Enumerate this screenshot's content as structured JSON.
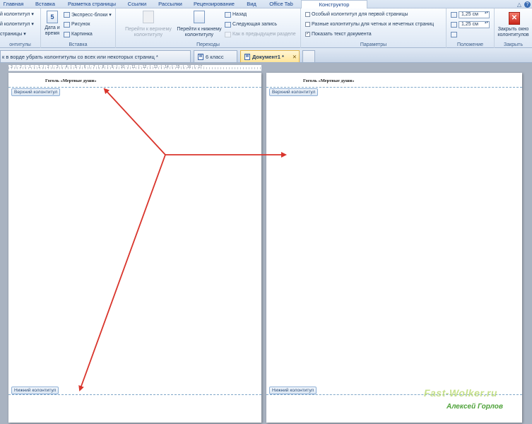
{
  "ribbon_tabs": [
    "Главная",
    "Вставка",
    "Разметка страницы",
    "Ссылки",
    "Рассылки",
    "Рецензирование",
    "Вид",
    "Office Tab",
    "Конструктор"
  ],
  "window_icons": [
    "△",
    "?"
  ],
  "ribbon": {
    "group1": {
      "items": [
        "й колонтитул ▾",
        "й колонтитул ▾",
        "страницы ▾"
      ],
      "label": "онтитулы"
    },
    "insert": {
      "date_label_1": "Дата и",
      "date_label_2": "время",
      "date_icon_text": "5",
      "items": [
        "Экспресс-блоки ▾",
        "Рисунок",
        "Картинка"
      ],
      "label": "Вставка"
    },
    "nav": {
      "goto_header_1": "Перейти к верхнему",
      "goto_header_2": "колонтитулу",
      "goto_footer_1": "Перейти к нижнему",
      "goto_footer_2": "колонтитулу",
      "items": [
        "Назад",
        "Следующая запись",
        "Как в предыдущем разделе"
      ],
      "label": "Переходы"
    },
    "params": {
      "options": [
        {
          "label": "Особый колонтитул для первой страницы",
          "checked": false
        },
        {
          "label": "Разные колонтитулы для четных и нечетных страниц",
          "checked": false
        },
        {
          "label": "Показать текст документа",
          "checked": true
        }
      ],
      "label": "Параметры"
    },
    "position": {
      "header_value": "1,25 см",
      "footer_value": "1,25 см",
      "label": "Положение"
    },
    "close": {
      "button_1": "Закрыть окно",
      "button_2": "колонтитулов",
      "label": "Закрыть"
    }
  },
  "doc_tabs": [
    {
      "label": "к в ворде убрать  колонтитулы со всех или некоторых страниц *",
      "active": false
    },
    {
      "label": "6 класс",
      "active": false
    },
    {
      "label": "Документ1 *",
      "active": true
    },
    {
      "label": "",
      "active": false
    }
  ],
  "doc_icon_glyph": "W",
  "ruler_text": "· 3 · | · 2 · | · 1 · | · 1 · | · 2 · | · 3 · | · 4 · | · 5 · | · 6 · | · 7 · | · 8 · | · 9 · | · 10 · | · 11 · | · 12 · | · 13 · | · 14 · | · 15 · | · 16 · | · 17 ·",
  "pages": [
    {
      "header_text": "Гоголь «Мертвые души»",
      "header_tag": "Верхний колонтитул",
      "footer_tag": "Нижний колонтитул"
    },
    {
      "header_text": "Гоголь «Мертвые души»",
      "header_tag": "Верхний колонтитул",
      "footer_tag": "Нижний колонтитул"
    }
  ],
  "watermark": {
    "site": "Fast-Wolker.ru",
    "author": "Алексей Горлов"
  },
  "colors": {
    "arrow": "#d9342b",
    "accent": "#15428b"
  }
}
